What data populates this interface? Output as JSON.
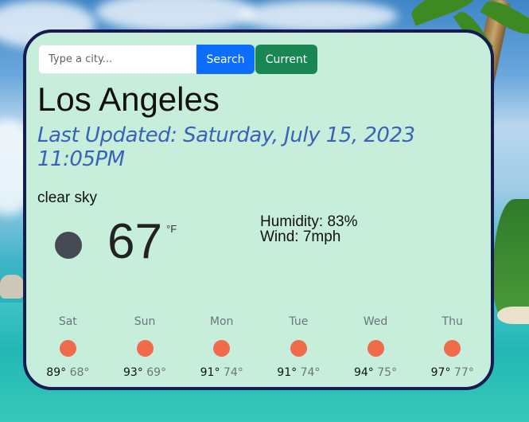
{
  "search": {
    "placeholder": "Type a city...",
    "search_label": "Search",
    "current_label": "Current"
  },
  "weather": {
    "city": "Los Angeles",
    "updated_line1": "Last Updated: Saturday, July 15, 2023",
    "updated_line2": "11:05PM",
    "description": "clear sky",
    "icon": "dark-circle-icon",
    "temperature": "67",
    "unit": "°F",
    "humidity": "Humidity: 83%",
    "wind": "Wind: 7mph"
  },
  "forecast": [
    {
      "day": "Sat",
      "high": "89°",
      "low": "68°"
    },
    {
      "day": "Sun",
      "high": "93°",
      "low": "69°"
    },
    {
      "day": "Mon",
      "high": "91°",
      "low": "74°"
    },
    {
      "day": "Tue",
      "high": "91°",
      "low": "74°"
    },
    {
      "day": "Wed",
      "high": "94°",
      "low": "75°"
    },
    {
      "day": "Thu",
      "high": "97°",
      "low": "77°"
    }
  ],
  "colors": {
    "card_bg": "#c6eedb",
    "card_border": "#171b52",
    "search_btn": "#0d6efd",
    "current_btn": "#198754",
    "updated_text": "#3a63b8",
    "forecast_icon": "#ef6b4c"
  }
}
